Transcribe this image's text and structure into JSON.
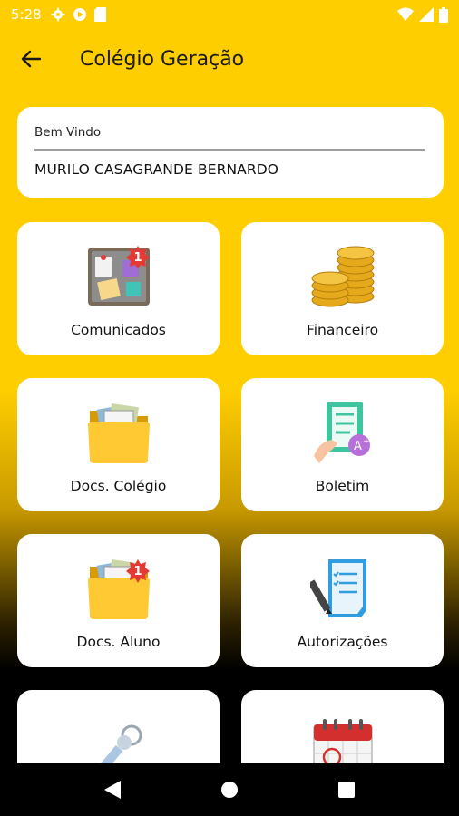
{
  "status_bar": {
    "time": "5:28",
    "left_icons": [
      "gear-icon",
      "play-icon",
      "sd-card-icon"
    ],
    "right_icons": [
      "wifi-icon",
      "signal-icon",
      "battery-icon"
    ]
  },
  "app_bar": {
    "back_icon": "arrow-left-icon",
    "title": "Colégio Geração"
  },
  "welcome": {
    "label": "Bem Vindo",
    "name": "MURILO CASAGRANDE BERNARDO"
  },
  "tiles": [
    {
      "label": "Comunicados",
      "icon": "bulletin-board-icon",
      "badge": "1"
    },
    {
      "label": "Financeiro",
      "icon": "coins-icon",
      "badge": null
    },
    {
      "label": "Docs. Colégio",
      "icon": "folder-icon",
      "badge": null
    },
    {
      "label": "Boletim",
      "icon": "report-card-icon",
      "badge": null
    },
    {
      "label": "Docs. Aluno",
      "icon": "folder-icon",
      "badge": "1"
    },
    {
      "label": "Autorizações",
      "icon": "signature-document-icon",
      "badge": null
    },
    {
      "label": "",
      "icon": "keys-icon",
      "badge": null
    },
    {
      "label": "",
      "icon": "calendar-icon",
      "badge": null
    }
  ],
  "nav_bar": {
    "buttons": [
      "back-triangle-icon",
      "home-circle-icon",
      "recents-square-icon"
    ]
  },
  "colors": {
    "background_top": "#FFCE00",
    "background_bottom": "#000000",
    "card": "#FFFFFF",
    "badge": "#E53935"
  }
}
